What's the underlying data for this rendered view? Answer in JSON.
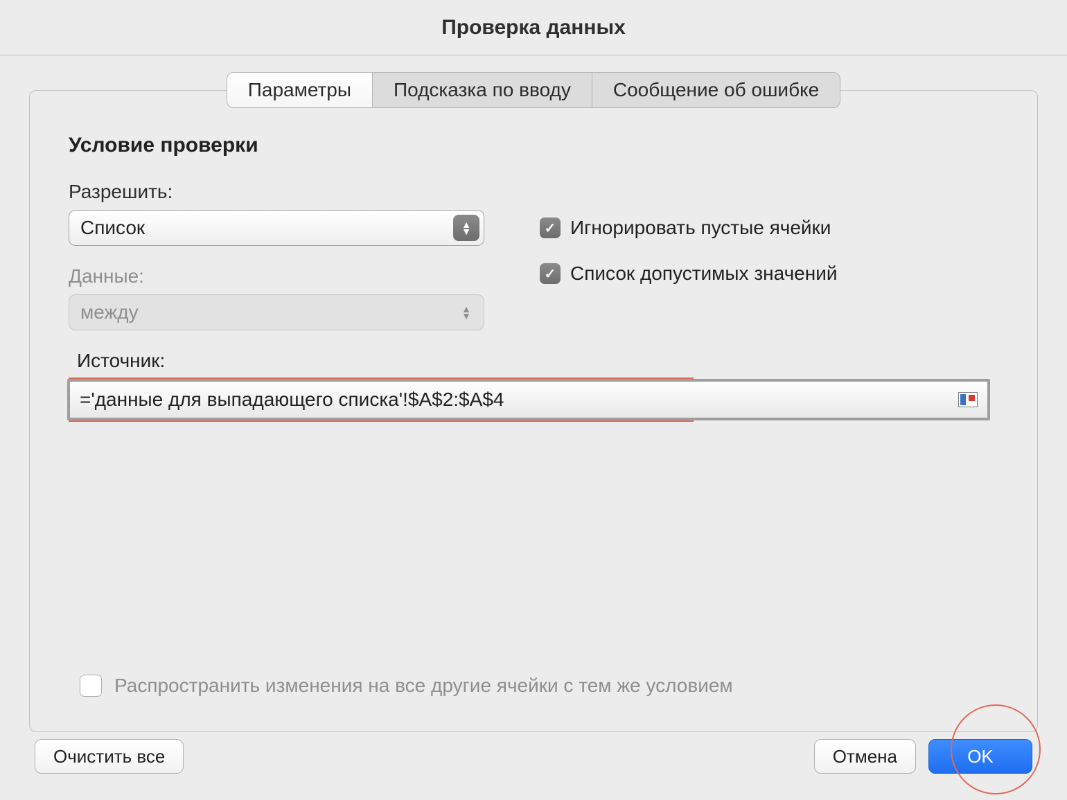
{
  "title": "Проверка данных",
  "tabs": {
    "parameters": "Параметры",
    "input_hint": "Подсказка по вводу",
    "error_message": "Сообщение об ошибке"
  },
  "section_title": "Условие проверки",
  "labels": {
    "allow": "Разрешить:",
    "data": "Данные:",
    "source": "Источник:"
  },
  "allow_combo": {
    "value": "Список"
  },
  "data_combo": {
    "value": "между"
  },
  "source_value": "='данные для выпадающего списка'!$A$2:$A$4",
  "checkboxes": {
    "ignore_empty": "Игнорировать пустые ячейки",
    "in_cell_dropdown": "Список допустимых значений",
    "apply_same": "Распространить изменения на все другие ячейки с тем же условием"
  },
  "buttons": {
    "clear_all": "Очистить все",
    "cancel": "Отмена",
    "ok": "OK"
  }
}
